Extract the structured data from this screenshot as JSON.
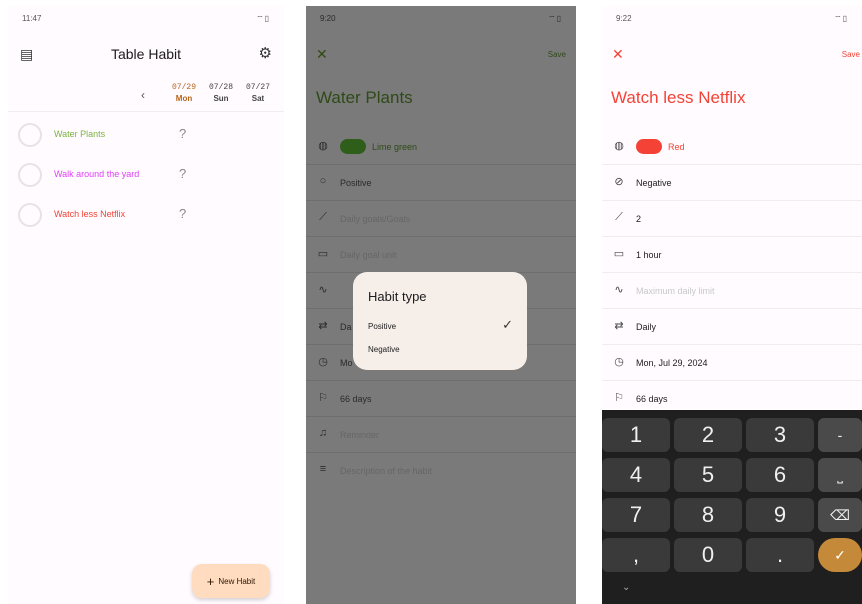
{
  "screen1": {
    "status": {
      "time": "11:47",
      "icons": "wifi battery"
    },
    "app_title": "Table Habit",
    "dates": [
      {
        "date": "07/29",
        "weekday": "Mon"
      },
      {
        "date": "07/28",
        "weekday": "Sun"
      },
      {
        "date": "07/27",
        "weekday": "Sat"
      }
    ],
    "habits": [
      {
        "name": "Water Plants",
        "color": "#7cb342",
        "value": "?"
      },
      {
        "name": "Walk around the yard",
        "color": "#e040fb",
        "value": "?"
      },
      {
        "name": "Watch less Netflix",
        "color": "#f44336",
        "value": "?"
      }
    ],
    "fab_label": "New Habit"
  },
  "screen2": {
    "status": {
      "time": "9:20",
      "icons": "wifi battery"
    },
    "save_label": "Save",
    "habit_name": "Water Plants",
    "fields": {
      "color": "Lime green",
      "type": "Positive",
      "daily_goal": "Daily goals/Goals",
      "unit": "Daily goal unit",
      "frequency_prefix": "Da",
      "start_prefix": "Mo",
      "target_days": "66 days",
      "reminder": "Reminder",
      "description": "Description of the habit"
    },
    "dialog": {
      "title": "Habit type",
      "options": [
        "Positive",
        "Negative"
      ],
      "selected": "Positive"
    }
  },
  "screen3": {
    "status": {
      "time": "9:22",
      "icons": "wifi battery"
    },
    "save_label": "Save",
    "habit_name": "Watch less Netflix",
    "fields": {
      "color": "Red",
      "type": "Negative",
      "goal_value": "2",
      "unit": "1 hour",
      "max_daily_placeholder": "Maximum daily limit",
      "frequency": "Daily",
      "start_date": "Mon, Jul 29, 2024",
      "target_days": "66 days"
    },
    "keypad": {
      "rows": [
        [
          "1",
          "2",
          "3",
          "-"
        ],
        [
          "4",
          "5",
          "6",
          "⎵"
        ],
        [
          "7",
          "8",
          "9",
          "⌫"
        ],
        [
          ",",
          "0",
          ".",
          "✓"
        ]
      ]
    }
  }
}
